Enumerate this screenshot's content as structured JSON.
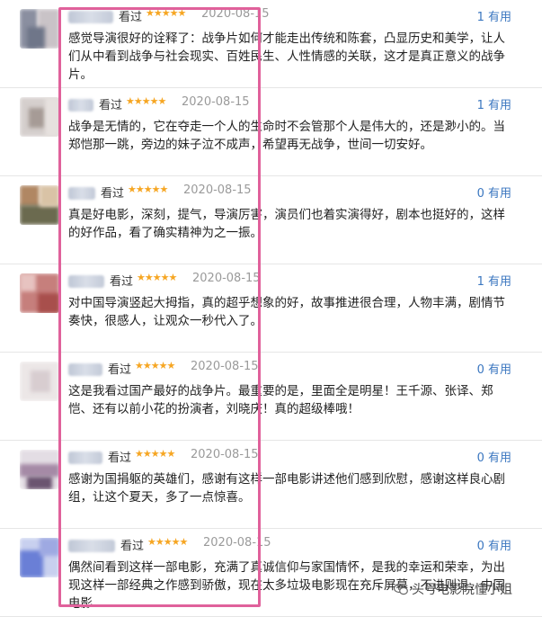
{
  "reviews": [
    {
      "watched": "看过",
      "stars": "★★★★★",
      "date": "2020-08-15",
      "useful": "1 有用",
      "text": "感觉导演很好的诠释了：战争片如何才能走出传统和陈套，凸显历史和美学，让人们从中看到战争与社会现实、百姓民生、人性情感的关联，这才是真正意义的战争片。"
    },
    {
      "watched": "看过",
      "stars": "★★★★★",
      "date": "2020-08-15",
      "useful": "1 有用",
      "text": "战争是无情的，它在夺走一个人的生命时不会管那个人是伟大的，还是渺小的。当郑恺那一跳，旁边的妹子泣不成声，希望再无战争，世间一切安好。"
    },
    {
      "watched": "看过",
      "stars": "★★★★★",
      "date": "2020-08-15",
      "useful": "0 有用",
      "text": "真是好电影，深刻，提气，导演厉害，演员们也着实演得好，剧本也挺好的，这样的好作品，看了确实精神为之一振。"
    },
    {
      "watched": "看过",
      "stars": "★★★★★",
      "date": "2020-08-15",
      "useful": "1 有用",
      "text": "对中国导演竖起大拇指，真的超乎想象的好，故事推进很合理，人物丰满，剧情节奏快，很感人，让观众一秒代入了。"
    },
    {
      "watched": "看过",
      "stars": "★★★★★",
      "date": "2020-08-15",
      "useful": "0 有用",
      "text": "这是我看过国产最好的战争片。最重要的是，里面全是明星！王千源、张译、郑恺、还有以前小花的扮演者，刘晓庆！真的超级棒哦！"
    },
    {
      "watched": "看过",
      "stars": "★★★★★",
      "date": "2020-08-15",
      "useful": "0 有用",
      "text": "感谢为国捐躯的英雄们，感谢有这样一部电影讲述他们感到欣慰，感谢这样良心剧组，让这个夏天，多了一点惊喜。"
    },
    {
      "watched": "看过",
      "stars": "★★★★★",
      "date": "2020-08-15",
      "useful": "0 有用",
      "text": "偶然间看到这样一部电影，充满了真诚信仰与家国情怀，是我的幸运和荣幸，为出现这样一部经典之作感到骄傲，现在太多垃圾电影现在充斥屏幕，不进则退，中国电影"
    }
  ],
  "watermark": "头号电影院懂小姐",
  "colors": {
    "highlight": "#e0619b",
    "useful": "#3b77c0",
    "star": "#f6a623"
  }
}
